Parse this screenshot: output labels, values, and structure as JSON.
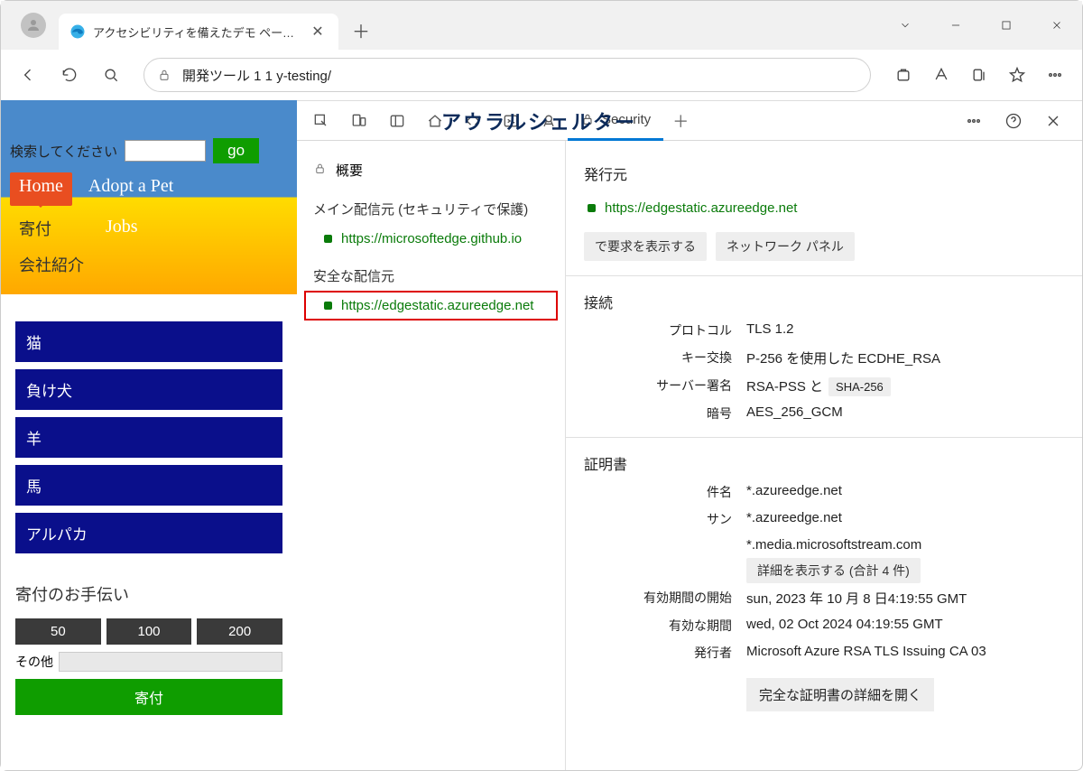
{
  "tab": {
    "title": "アクセシビリティを備えたデモ ページは、"
  },
  "address": {
    "text": "開発ツール 1 1 y-testing/"
  },
  "page": {
    "overlay": "アウラルシェルター",
    "search_label": "検索してください",
    "go": "go",
    "nav": {
      "home": "Home",
      "adopt": "Adopt a Pet",
      "donate": "寄付",
      "jobs": "Jobs",
      "about": "会社紹介"
    },
    "categories": [
      "猫",
      "負け犬",
      "羊",
      "馬",
      "アルパカ"
    ],
    "donate_section": {
      "heading": "寄付のお手伝い",
      "amounts": [
        "50",
        "100",
        "200"
      ],
      "other": "その他",
      "submit": "寄付"
    }
  },
  "devtools": {
    "security_tab": "Security",
    "left": {
      "overview": "概要",
      "main_origin_head": "メイン配信元 (セキュリティで保護)",
      "main_origin": "https://microsoftedge.github.io",
      "safe_origin_head": "安全な配信元",
      "safe_origin": "https://edgestatic.azureedge.net"
    },
    "right": {
      "issuer_head": "発行元",
      "issuer_origin": "https://edgestatic.azureedge.net",
      "btn_show_req": "で要求を表示する",
      "btn_net_panel": "ネットワーク パネル",
      "conn_head": "接続",
      "protocol_k": "プロトコル",
      "protocol_v": "TLS 1.2",
      "kex_k": "キー交換",
      "kex_v": "P-256 を使用した ECDHE_RSA",
      "sig_k": "サーバー署名",
      "sig_v": "RSA-PSS と",
      "sig_hash": "SHA-256",
      "cipher_k": "暗号",
      "cipher_v": "AES_256_GCM",
      "cert_head": "証明書",
      "subj_k": "件名",
      "subj_v": "*.azureedge.net",
      "san_k": "サン",
      "san_v1": "*.azureedge.net",
      "san_v2": "*.media.microsoftstream.com",
      "san_more": "詳細を表示する (合計 4 件)",
      "valid_from_k": "有効期間の開始",
      "valid_from_v": "sun, 2023 年 10 月 8 日4:19:55 GMT",
      "valid_to_k": "有効な期間",
      "valid_to_v": "wed, 02 Oct 2024 04:19:55 GMT",
      "cert_issuer_k": "発行者",
      "cert_issuer_v": "Microsoft Azure RSA TLS Issuing CA 03",
      "open_cert": "完全な証明書の詳細を開く"
    }
  }
}
